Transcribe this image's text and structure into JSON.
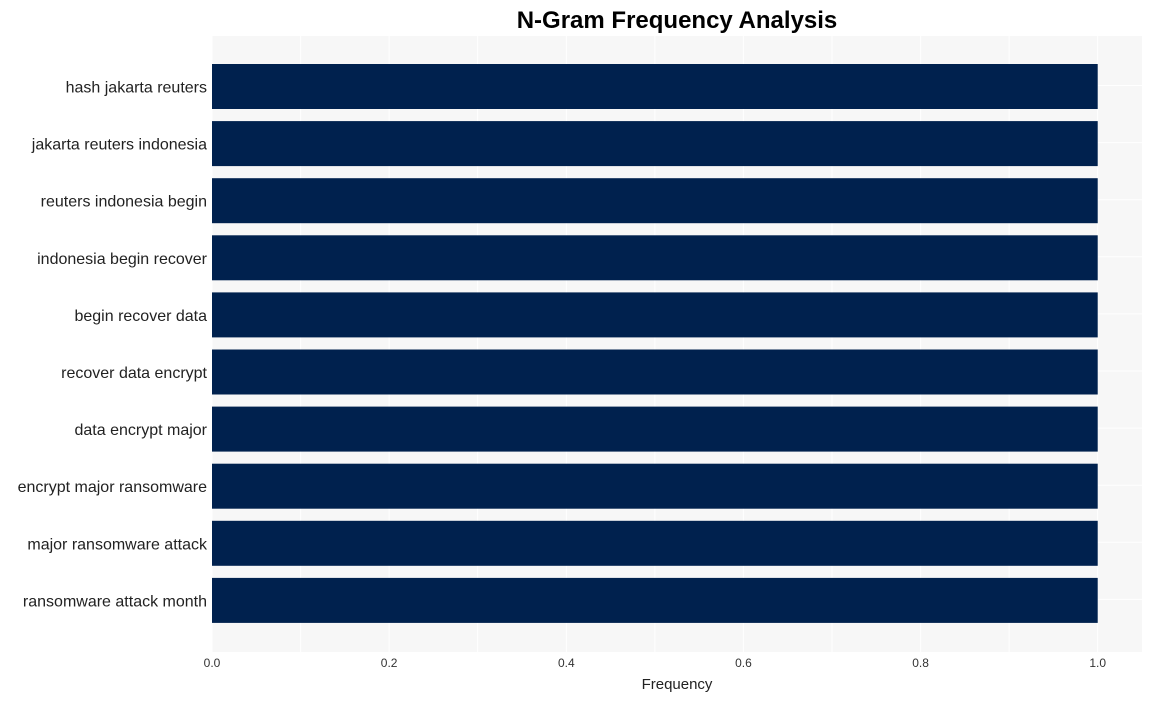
{
  "chart_data": {
    "type": "bar",
    "orientation": "horizontal",
    "title": "N-Gram Frequency Analysis",
    "xlabel": "Frequency",
    "ylabel": "",
    "categories": [
      "hash jakarta reuters",
      "jakarta reuters indonesia",
      "reuters indonesia begin",
      "indonesia begin recover",
      "begin recover data",
      "recover data encrypt",
      "data encrypt major",
      "encrypt major ransomware",
      "major ransomware attack",
      "ransomware attack month"
    ],
    "values": [
      1,
      1,
      1,
      1,
      1,
      1,
      1,
      1,
      1,
      1
    ],
    "xlim": [
      0,
      1.05
    ],
    "xticks": [
      0.0,
      0.2,
      0.4,
      0.6,
      0.8,
      1.0
    ],
    "xtick_labels": [
      "0.0",
      "0.2",
      "0.4",
      "0.6",
      "0.8",
      "1.0"
    ],
    "grid": true,
    "legend": "none",
    "colors": {
      "bar": "#00214E",
      "plot_background": "#F7F7F7",
      "grid": "#FFFFFF"
    }
  }
}
